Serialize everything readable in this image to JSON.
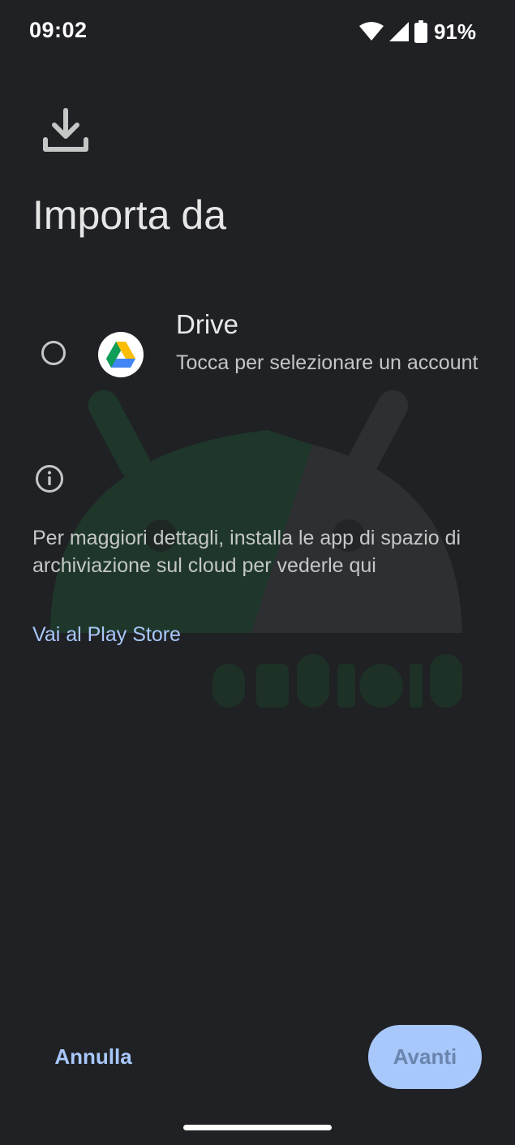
{
  "status_bar": {
    "time": "09:02",
    "battery_percent": "91%",
    "icons": [
      "wifi-icon",
      "signal-icon",
      "battery-icon"
    ]
  },
  "header": {
    "icon": "download-icon",
    "title": "Importa da"
  },
  "options": [
    {
      "icon": "google-drive-icon",
      "title": "Drive",
      "subtitle": "Tocca per selezionare un account",
      "selected": false
    }
  ],
  "info": {
    "icon": "info-icon",
    "text": "Per maggiori dettagli, installa le app di spazio di archiviazione sul cloud per vederle qui",
    "link_label": "Vai al Play Store"
  },
  "actions": {
    "cancel_label": "Annulla",
    "next_label": "Avanti",
    "next_enabled": false
  },
  "colors": {
    "background": "#1f2124",
    "accent": "#a8c7fa",
    "text_primary": "#e6e6e6",
    "text_secondary": "#c4c7c5"
  }
}
